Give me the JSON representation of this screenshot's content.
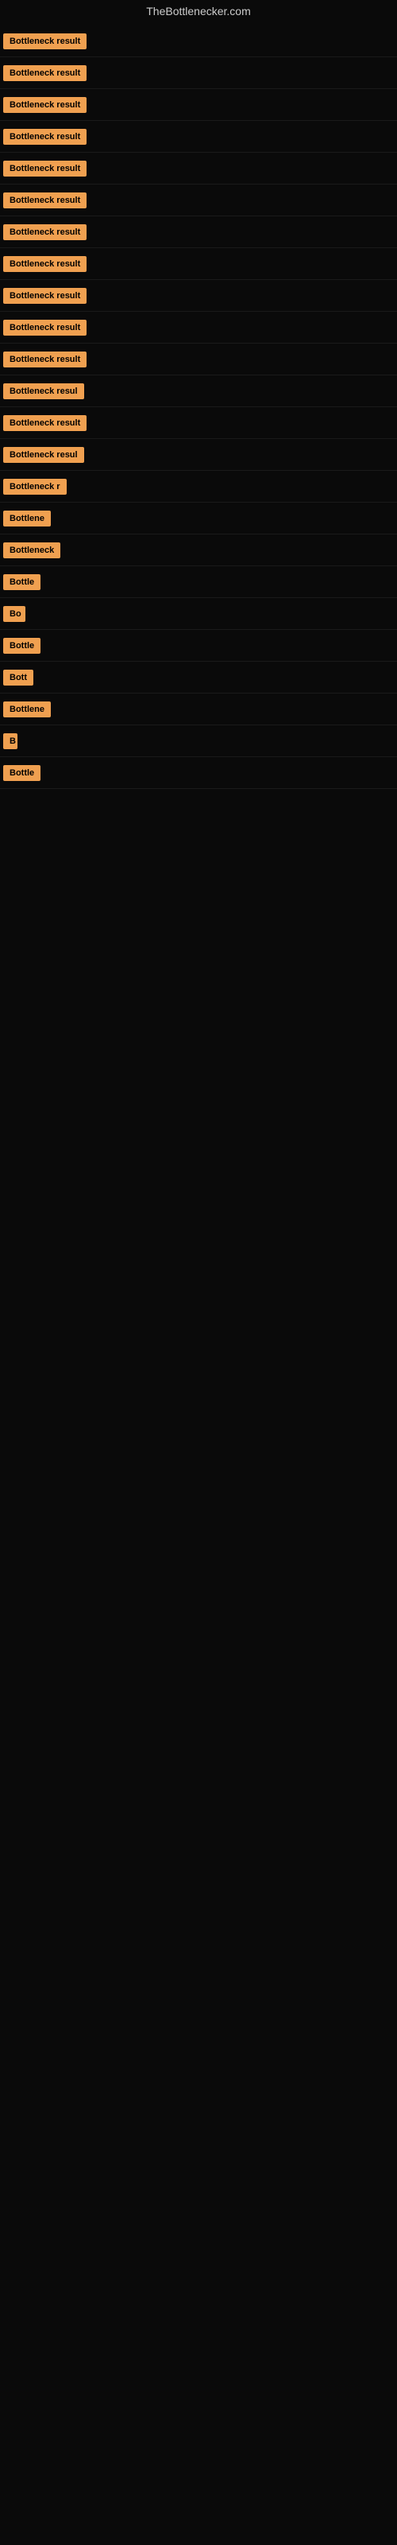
{
  "site": {
    "title": "TheBottlenecker.com"
  },
  "rows": [
    {
      "id": 1,
      "label": "Bottleneck result",
      "width": 130
    },
    {
      "id": 2,
      "label": "Bottleneck result",
      "width": 130
    },
    {
      "id": 3,
      "label": "Bottleneck result",
      "width": 130
    },
    {
      "id": 4,
      "label": "Bottleneck result",
      "width": 130
    },
    {
      "id": 5,
      "label": "Bottleneck result",
      "width": 130
    },
    {
      "id": 6,
      "label": "Bottleneck result",
      "width": 130
    },
    {
      "id": 7,
      "label": "Bottleneck result",
      "width": 130
    },
    {
      "id": 8,
      "label": "Bottleneck result",
      "width": 130
    },
    {
      "id": 9,
      "label": "Bottleneck result",
      "width": 130
    },
    {
      "id": 10,
      "label": "Bottleneck result",
      "width": 130
    },
    {
      "id": 11,
      "label": "Bottleneck result",
      "width": 130
    },
    {
      "id": 12,
      "label": "Bottleneck resul",
      "width": 115
    },
    {
      "id": 13,
      "label": "Bottleneck result",
      "width": 118
    },
    {
      "id": 14,
      "label": "Bottleneck resul",
      "width": 112
    },
    {
      "id": 15,
      "label": "Bottleneck r",
      "width": 85
    },
    {
      "id": 16,
      "label": "Bottlene",
      "width": 72
    },
    {
      "id": 17,
      "label": "Bottleneck",
      "width": 78
    },
    {
      "id": 18,
      "label": "Bottle",
      "width": 56
    },
    {
      "id": 19,
      "label": "Bo",
      "width": 28
    },
    {
      "id": 20,
      "label": "Bottle",
      "width": 56
    },
    {
      "id": 21,
      "label": "Bott",
      "width": 40
    },
    {
      "id": 22,
      "label": "Bottlene",
      "width": 68
    },
    {
      "id": 23,
      "label": "B",
      "width": 18
    },
    {
      "id": 24,
      "label": "Bottle",
      "width": 56
    }
  ],
  "colors": {
    "badge_bg": "#f0a050",
    "badge_text": "#000000",
    "page_bg": "#0a0a0a",
    "site_title": "#cccccc"
  }
}
